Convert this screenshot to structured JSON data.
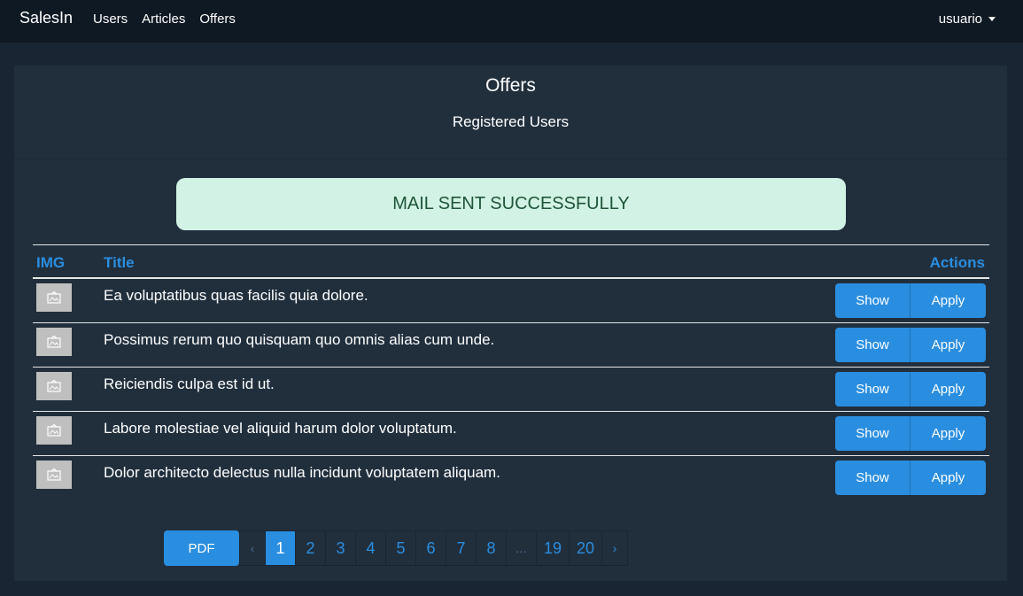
{
  "navbar": {
    "brand": "SalesIn",
    "links": [
      "Users",
      "Articles",
      "Offers"
    ],
    "user": "usuario"
  },
  "card": {
    "title": "Offers",
    "subtitle": "Registered Users"
  },
  "alert": "MAIL SENT SUCCESSFULLY",
  "table": {
    "headers": {
      "img": "IMG",
      "title": "Title",
      "actions": "Actions"
    },
    "rows": [
      {
        "title": "Ea voluptatibus quas facilis quia dolore.",
        "show": "Show",
        "apply": "Apply"
      },
      {
        "title": "Possimus rerum quo quisquam quo omnis alias cum unde.",
        "show": "Show",
        "apply": "Apply"
      },
      {
        "title": "Reiciendis culpa est id ut.",
        "show": "Show",
        "apply": "Apply"
      },
      {
        "title": "Labore molestiae vel aliquid harum dolor voluptatum.",
        "show": "Show",
        "apply": "Apply"
      },
      {
        "title": "Dolor architecto delectus nulla incidunt voluptatem aliquam.",
        "show": "Show",
        "apply": "Apply"
      }
    ]
  },
  "pdf_button": "PDF",
  "pagination": {
    "prev": "‹",
    "pages": [
      "1",
      "2",
      "3",
      "4",
      "5",
      "6",
      "7",
      "8",
      "...",
      "19",
      "20"
    ],
    "active": "1",
    "next": "›"
  },
  "colors": {
    "accent": "#2a8ee0",
    "navbar_bg": "#0f1923",
    "card_bg": "#212f3d",
    "alert_bg": "#d1f2e4",
    "alert_text": "#1f5538"
  },
  "icons": {
    "row_thumb": "image-placeholder-icon",
    "user_menu": "caret-down-icon"
  }
}
